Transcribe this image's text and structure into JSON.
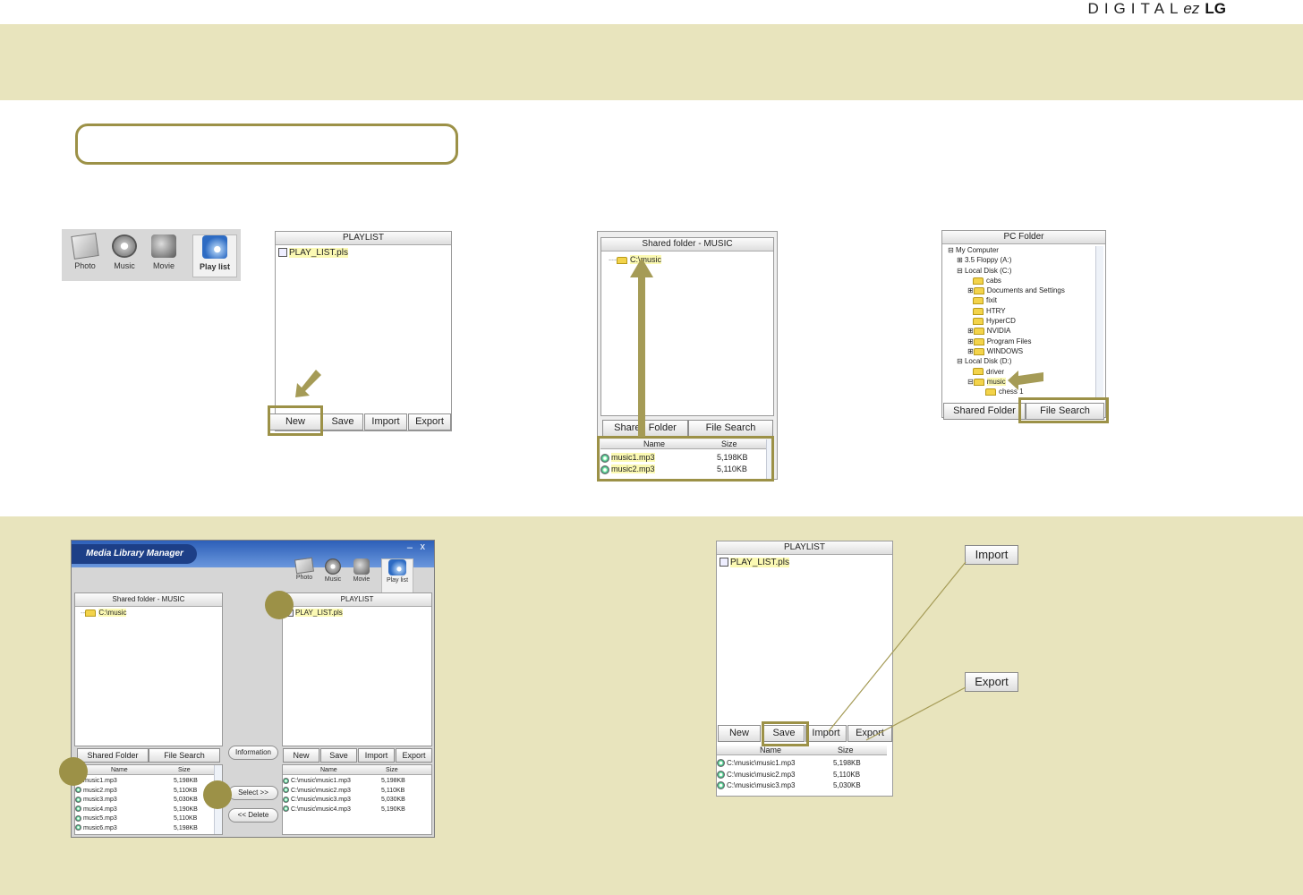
{
  "brand": {
    "digital": "DIGITAL",
    "ez": "ez",
    "lg": "LG"
  },
  "colors": {
    "band": "#e8e4bd",
    "accent": "#9c9147"
  },
  "icon_strip": {
    "items": [
      {
        "label": "Photo",
        "icon": "photo-icon"
      },
      {
        "label": "Music",
        "icon": "music-icon"
      },
      {
        "label": "Movie",
        "icon": "movie-icon"
      },
      {
        "label": "Play list",
        "icon": "playlist-icon",
        "active": true
      }
    ]
  },
  "playlist_small": {
    "title": "PLAYLIST",
    "file": "PLAY_LIST.pls",
    "buttons": [
      "New",
      "Save",
      "Import",
      "Export"
    ],
    "highlighted": "New"
  },
  "shared_small": {
    "title": "Shared folder - MUSIC",
    "root": "C:\\music",
    "tabs": [
      "Shared Folder",
      "File Search"
    ],
    "columns": [
      "Name",
      "Size"
    ],
    "rows": [
      {
        "name": "music1.mp3",
        "size": "5,198KB"
      },
      {
        "name": "music2.mp3",
        "size": "5,110KB"
      }
    ]
  },
  "pc_folder": {
    "title": "PC Folder",
    "tree": [
      "My Computer",
      "3.5 Floppy (A:)",
      "Local Disk (C:)",
      "cabs",
      "Documents and Settings",
      "fixit",
      "HTRY",
      "HyperCD",
      "NVIDIA",
      "Program Files",
      "WINDOWS",
      "Local Disk (D:)",
      "driver",
      "music",
      "chess 1"
    ],
    "tabs": [
      "Shared Folder",
      "File Search"
    ],
    "highlighted": "File Search"
  },
  "mlm": {
    "title": "Media Library Manager",
    "win_controls": [
      "–",
      "x"
    ],
    "icons": [
      "Photo",
      "Music",
      "Movie",
      "Play list"
    ],
    "shared_title": "Shared folder - MUSIC",
    "shared_root": "C:\\music",
    "playlist_title": "PLAYLIST",
    "playlist_file": "PLAY_LIST.pls",
    "tabs": [
      "Shared Folder",
      "File Search"
    ],
    "middle_buttons": [
      "Information",
      "Select >>",
      "<< Delete"
    ],
    "playlist_buttons": [
      "New",
      "Save",
      "Import",
      "Export"
    ],
    "columns": [
      "Name",
      "Size"
    ],
    "left_rows": [
      {
        "name": "music1.mp3",
        "size": "5,198KB"
      },
      {
        "name": "music2.mp3",
        "size": "5,110KB"
      },
      {
        "name": "music3.mp3",
        "size": "5,030KB"
      },
      {
        "name": "music4.mp3",
        "size": "5,190KB"
      },
      {
        "name": "music5.mp3",
        "size": "5,110KB"
      },
      {
        "name": "music6.mp3",
        "size": "5,198KB"
      }
    ],
    "right_rows": [
      {
        "name": "C:\\music\\music1.mp3",
        "size": "5,198KB"
      },
      {
        "name": "C:\\music\\music2.mp3",
        "size": "5,110KB"
      },
      {
        "name": "C:\\music\\music3.mp3",
        "size": "5,030KB"
      },
      {
        "name": "C:\\music\\music4.mp3",
        "size": "5,190KB"
      }
    ]
  },
  "playlist_large": {
    "title": "PLAYLIST",
    "file": "PLAY_LIST.pls",
    "buttons": [
      "New",
      "Save",
      "Import",
      "Export"
    ],
    "highlighted": "Save",
    "columns": [
      "Name",
      "Size"
    ],
    "rows": [
      {
        "name": "C:\\music\\music1.mp3",
        "size": "5,198KB"
      },
      {
        "name": "C:\\music\\music2.mp3",
        "size": "5,110KB"
      },
      {
        "name": "C:\\music\\music3.mp3",
        "size": "5,030KB"
      }
    ]
  },
  "callouts": {
    "import": "Import",
    "export": "Export"
  }
}
